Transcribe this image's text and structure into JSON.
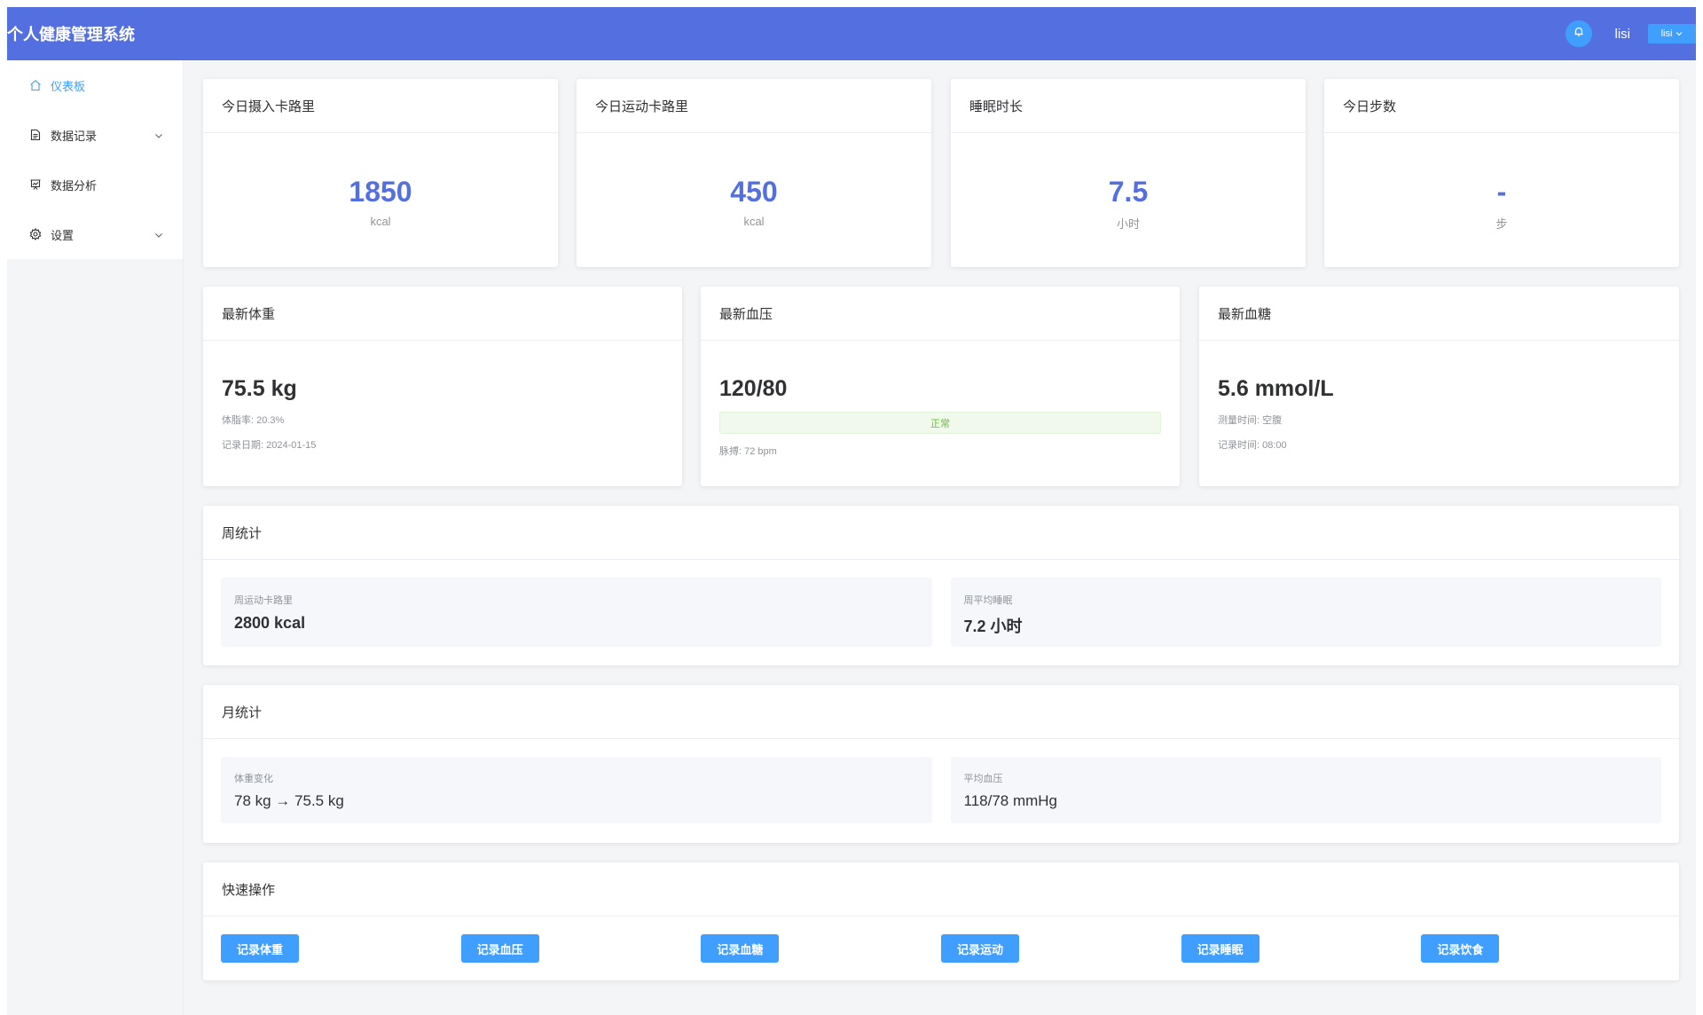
{
  "header": {
    "title": "个人健康管理系统",
    "username": "lisi",
    "user_dropdown": "lisi"
  },
  "sidebar": {
    "items": [
      {
        "label": "仪表板",
        "icon": "home-icon",
        "active": true
      },
      {
        "label": "数据记录",
        "icon": "document-icon",
        "expandable": true
      },
      {
        "label": "数据分析",
        "icon": "chart-icon"
      },
      {
        "label": "设置",
        "icon": "gear-icon",
        "expandable": true
      }
    ]
  },
  "stats": [
    {
      "title": "今日摄入卡路里",
      "value": "1850",
      "unit": "kcal"
    },
    {
      "title": "今日运动卡路里",
      "value": "450",
      "unit": "kcal"
    },
    {
      "title": "睡眠时长",
      "value": "7.5",
      "unit": "小时"
    },
    {
      "title": "今日步数",
      "value": "-",
      "unit": "步"
    }
  ],
  "latest": {
    "weight": {
      "title": "最新体重",
      "value": "75.5 kg",
      "sub1": "体脂率: 20.3%",
      "sub2": "记录日期: 2024-01-15"
    },
    "bp": {
      "title": "最新血压",
      "value": "120/80",
      "tag": "正常",
      "sub1": "脉搏: 72 bpm"
    },
    "glucose": {
      "title": "最新血糖",
      "value": "5.6 mmol/L",
      "sub1": "测量时间: 空腹",
      "sub2": "记录时间: 08:00"
    }
  },
  "weekly": {
    "title": "周统计",
    "items": [
      {
        "label": "周运动卡路里",
        "value": "2800 kcal"
      },
      {
        "label": "周平均睡眠",
        "value": "7.2 小时"
      }
    ]
  },
  "monthly": {
    "title": "月统计",
    "items": [
      {
        "label": "体重变化",
        "value": "78 kg → 75.5 kg"
      },
      {
        "label": "平均血压",
        "value": "118/78 mmHg"
      }
    ]
  },
  "quick": {
    "title": "快速操作",
    "buttons": [
      "记录体重",
      "记录血压",
      "记录血糖",
      "记录运动",
      "记录睡眠",
      "记录饮食"
    ]
  },
  "colors": {
    "header": "#5470e0",
    "primary": "#409eff",
    "stat_value": "#5470e0",
    "success": "#67c23a"
  }
}
